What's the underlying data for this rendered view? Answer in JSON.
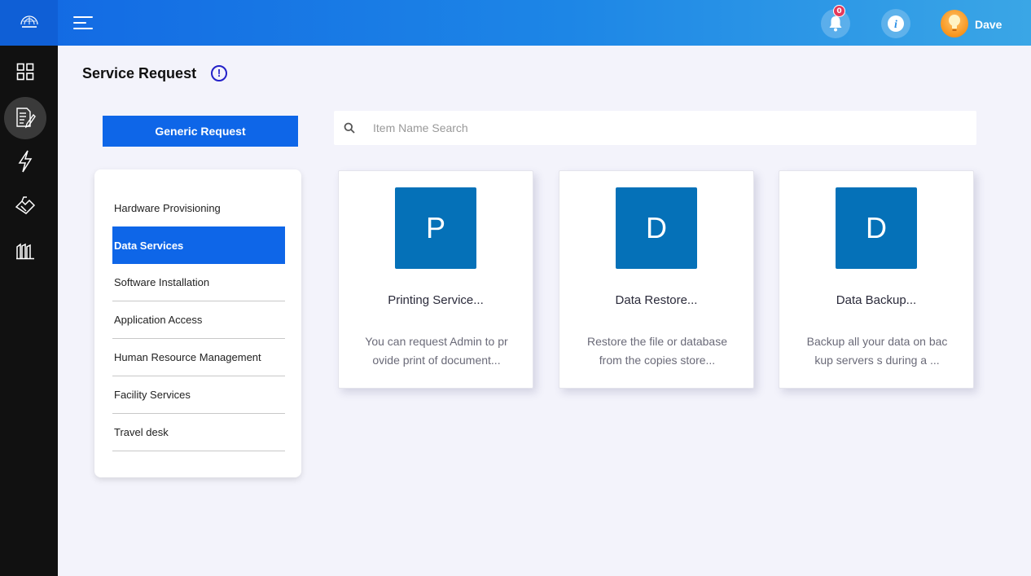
{
  "header": {
    "logo_icon": "globe-logo-icon",
    "menu_icon": "hamburger-menu-icon",
    "notification_count": "0",
    "info_icon": "info-icon",
    "avatar_icon": "lightbulb-avatar-icon",
    "user_name": "Dave"
  },
  "sidebar": {
    "items": [
      {
        "name": "dashboard",
        "icon": "grid-icon"
      },
      {
        "name": "service-request",
        "icon": "document-edit-icon",
        "active": true
      },
      {
        "name": "incidents",
        "icon": "lightning-icon"
      },
      {
        "name": "approvals",
        "icon": "handshake-icon"
      },
      {
        "name": "reports",
        "icon": "building-icon"
      }
    ]
  },
  "page": {
    "title": "Service Request",
    "info_glyph": "!"
  },
  "generic_button_label": "Generic Request",
  "search": {
    "placeholder": "Item Name Search",
    "value": "",
    "icon": "search-icon"
  },
  "categories": [
    {
      "label": "Hardware Provisioning"
    },
    {
      "label": "Data Services",
      "active": true
    },
    {
      "label": "Software Installation"
    },
    {
      "label": "Application Access"
    },
    {
      "label": "Human Resource Management"
    },
    {
      "label": "Facility Services"
    },
    {
      "label": "Travel desk"
    }
  ],
  "cards": [
    {
      "letter": "P",
      "title": "Printing Service...",
      "line1": "You can request Admin to pr",
      "line2": "ovide print of document..."
    },
    {
      "letter": "D",
      "title": "Data Restore...",
      "line1": "Restore the file or database",
      "line2": "from the copies store..."
    },
    {
      "letter": "D",
      "title": "Data Backup...",
      "line1": "Backup all your data on bac",
      "line2": "kup servers s during a ..."
    }
  ],
  "colors": {
    "primary": "#0e66e8",
    "tile": "#0571b8",
    "sidebar": "#111111",
    "badge": "#e5395a"
  }
}
